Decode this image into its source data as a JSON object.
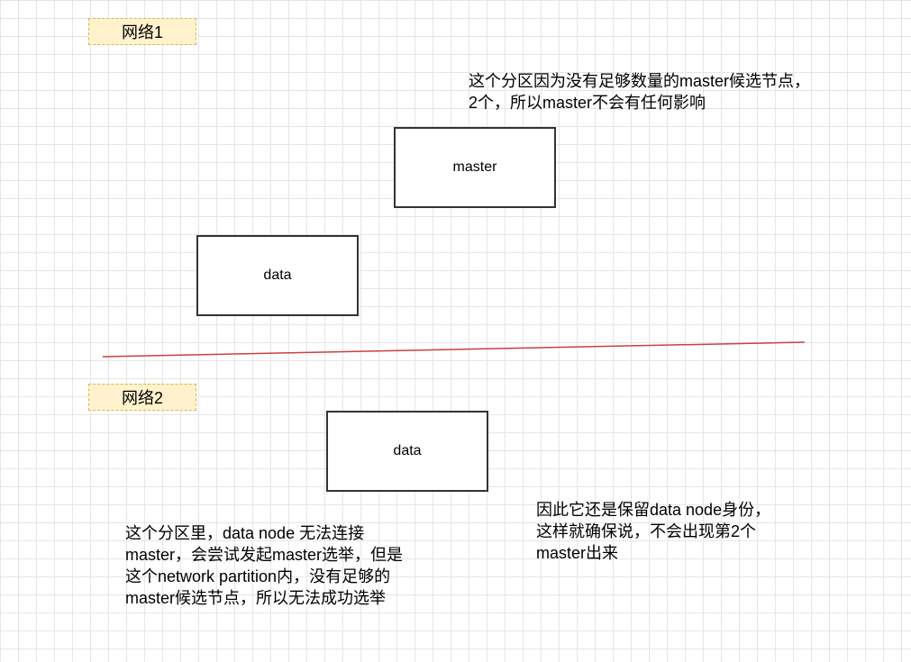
{
  "network1": {
    "label": "网络1"
  },
  "network2": {
    "label": "网络2"
  },
  "nodes": {
    "net1_master": "master",
    "net1_data": "data",
    "net2_data": "data"
  },
  "notes": {
    "net1_note": [
      "这个分区因为没有足够数量的master候选节点，",
      "2个，所以master不会有任何影响"
    ],
    "net2_note_left": [
      "这个分区里，data node 无法连接",
      "master，会尝试发起master选举，但是",
      "这个network partition内，没有足够的",
      "master候选节点，所以无法成功选举"
    ],
    "net2_note_right": [
      "因此它还是保留data node身份，",
      "这样就确保说，不会出现第2个",
      "master出来"
    ]
  },
  "colors": {
    "divider": "#c94040",
    "label_fill": "#fff2cc",
    "label_border": "#d6b656",
    "node_border": "#333333"
  }
}
